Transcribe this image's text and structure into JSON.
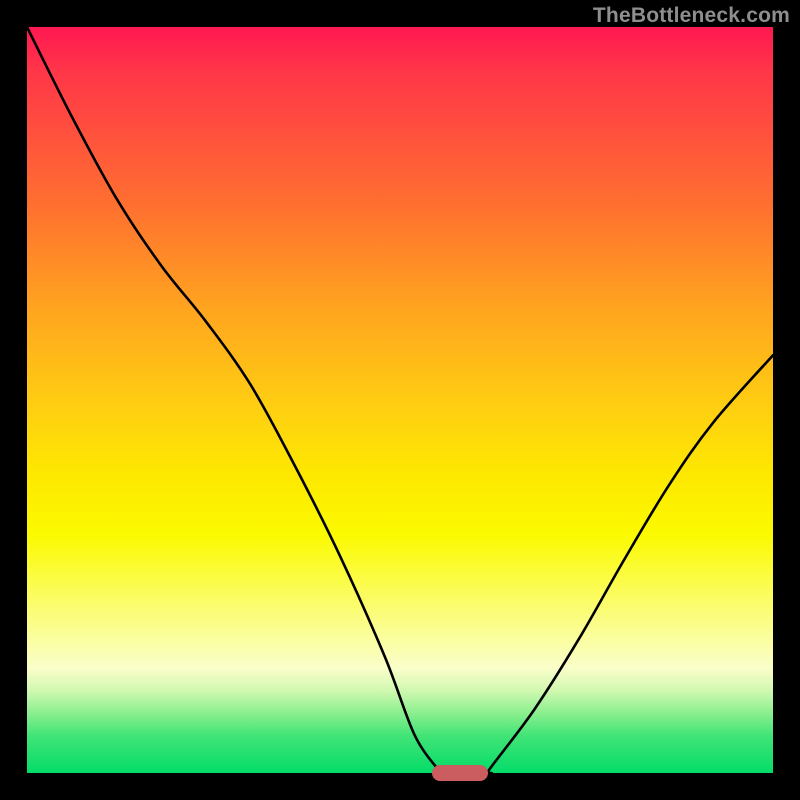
{
  "watermark": "TheBottleneck.com",
  "colors": {
    "frame": "#000000",
    "marker": "#cb5d61",
    "curve": "#000000"
  },
  "chart_data": {
    "type": "line",
    "title": "",
    "xlabel": "",
    "ylabel": "",
    "xlim": [
      0,
      1
    ],
    "ylim": [
      0,
      1
    ],
    "series": [
      {
        "name": "left-branch",
        "x": [
          0.0,
          0.06,
          0.12,
          0.18,
          0.24,
          0.3,
          0.36,
          0.42,
          0.48,
          0.52,
          0.555
        ],
        "y": [
          1.0,
          0.88,
          0.77,
          0.68,
          0.605,
          0.52,
          0.41,
          0.29,
          0.155,
          0.05,
          0.0
        ]
      },
      {
        "name": "valley-floor",
        "x": [
          0.555,
          0.62
        ],
        "y": [
          0.0,
          0.0
        ]
      },
      {
        "name": "right-branch",
        "x": [
          0.62,
          0.68,
          0.74,
          0.8,
          0.86,
          0.92,
          1.0
        ],
        "y": [
          0.005,
          0.085,
          0.18,
          0.285,
          0.385,
          0.47,
          0.56
        ]
      }
    ],
    "marker": {
      "x_center": 0.58,
      "y_center": 0.0,
      "width_frac": 0.075,
      "height_frac": 0.022
    }
  }
}
